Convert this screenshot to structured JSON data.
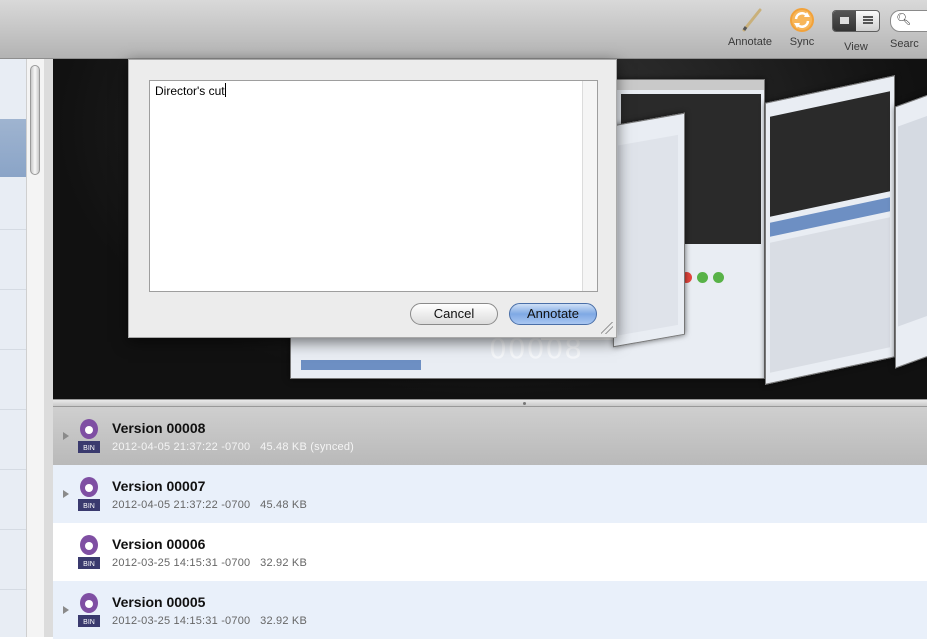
{
  "toolbar": {
    "annotate_label": "Annotate",
    "sync_label": "Sync",
    "view_label": "View",
    "search_label": "Searc"
  },
  "preview": {
    "version_number": "00008"
  },
  "annotation_sheet": {
    "text": "Director's cut",
    "cancel_label": "Cancel",
    "annotate_label": "Annotate"
  },
  "versions": [
    {
      "title": "Version 00008",
      "date": "2012-04-05 21:37:22 -0700",
      "size": "45.48 KB",
      "status": "(synced)",
      "style": "sel",
      "has_disclosure": true
    },
    {
      "title": "Version 00007",
      "date": "2012-04-05 21:37:22 -0700",
      "size": "45.48 KB",
      "status": "",
      "style": "alt",
      "has_disclosure": true
    },
    {
      "title": "Version 00006",
      "date": "2012-03-25 14:15:31 -0700",
      "size": "32.92 KB",
      "status": "",
      "style": "plain",
      "has_disclosure": false
    },
    {
      "title": "Version 00005",
      "date": "2012-03-25 14:15:31 -0700",
      "size": "32.92 KB",
      "status": "",
      "style": "alt",
      "has_disclosure": true
    }
  ],
  "file_icon": {
    "badge": "BIN",
    "name": "bin-file-icon"
  }
}
